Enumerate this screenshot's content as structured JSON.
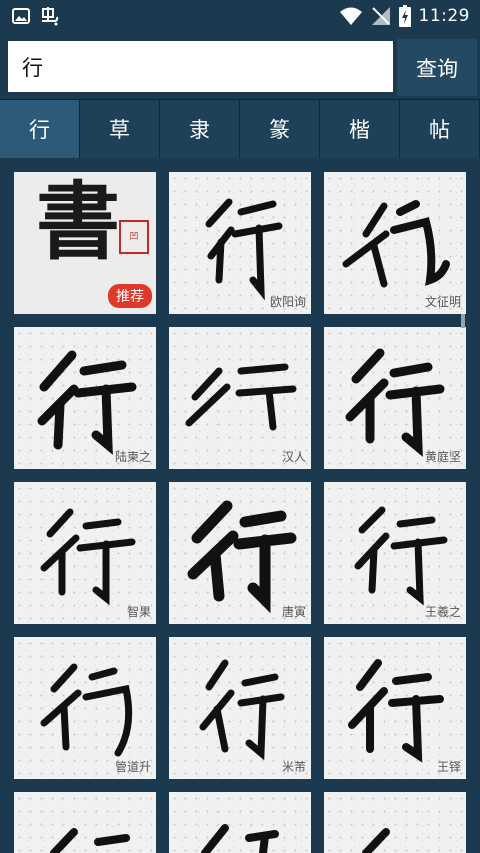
{
  "status_bar": {
    "time": "11:29",
    "left_icons": [
      "image-icon",
      "app-bug-icon"
    ],
    "right_icons": [
      "wifi-icon",
      "no-signal-icon",
      "battery-icon"
    ]
  },
  "search": {
    "value": "行",
    "button_label": "查询"
  },
  "tabs": [
    {
      "label": "行",
      "active": true
    },
    {
      "label": "草",
      "active": false
    },
    {
      "label": "隶",
      "active": false
    },
    {
      "label": "篆",
      "active": false
    },
    {
      "label": "楷",
      "active": false
    },
    {
      "label": "帖",
      "active": false
    }
  ],
  "featured": {
    "glyph": "書",
    "seal_text": "凹",
    "badge": "推荐"
  },
  "cards": [
    {
      "author": "欧阳询"
    },
    {
      "author": "文征明"
    },
    {
      "author": "陆柬之"
    },
    {
      "author": "汉人"
    },
    {
      "author": "黄庭坚"
    },
    {
      "author": "智果"
    },
    {
      "author": "唐寅"
    },
    {
      "author": "王羲之"
    },
    {
      "author": "管道升"
    },
    {
      "author": "米芾"
    },
    {
      "author": "王铎"
    }
  ],
  "colors": {
    "background": "#1b3a4f",
    "tab_active": "#2d5a78",
    "badge": "#e0392b"
  }
}
